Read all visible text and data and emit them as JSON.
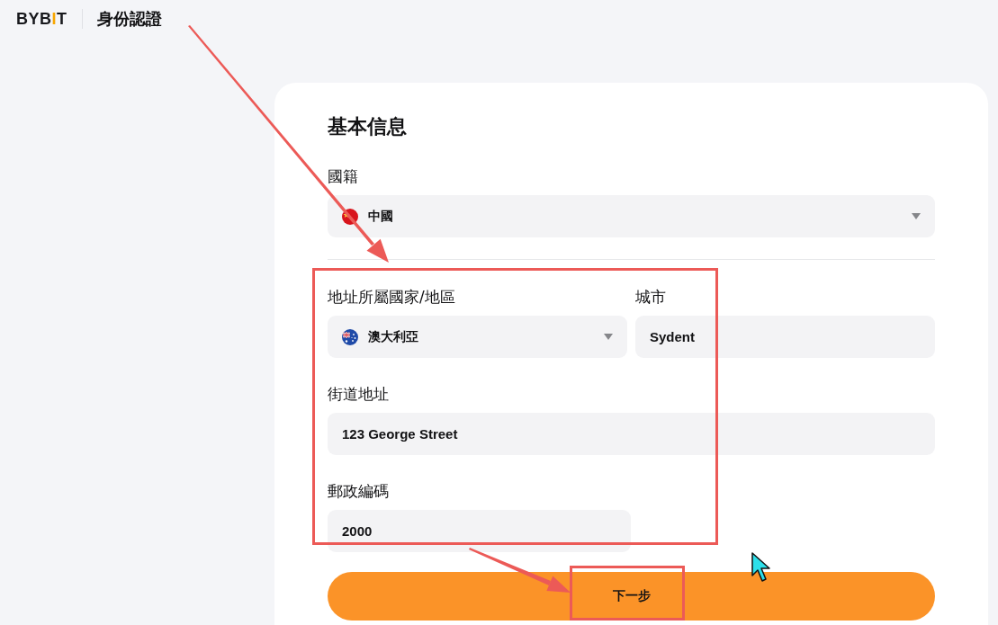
{
  "header": {
    "logo": [
      {
        "text": "BYB",
        "accent": false
      },
      {
        "text": "I",
        "accent": true
      },
      {
        "text": "T",
        "accent": false
      }
    ],
    "title": "身份認證"
  },
  "form": {
    "heading": "基本信息",
    "nationality": {
      "label": "國籍",
      "value": "中國",
      "flag": {
        "kind": "cn"
      }
    },
    "address_country": {
      "label": "地址所屬國家/地區",
      "value": "澳大利亞",
      "flag": {
        "kind": "au"
      }
    },
    "city": {
      "label": "城市",
      "value": "Sydent"
    },
    "street": {
      "label": "街道地址",
      "value": "123 George Street"
    },
    "postal_code": {
      "label": "郵政編碼",
      "value": "2000"
    },
    "next_button": "下一步"
  }
}
